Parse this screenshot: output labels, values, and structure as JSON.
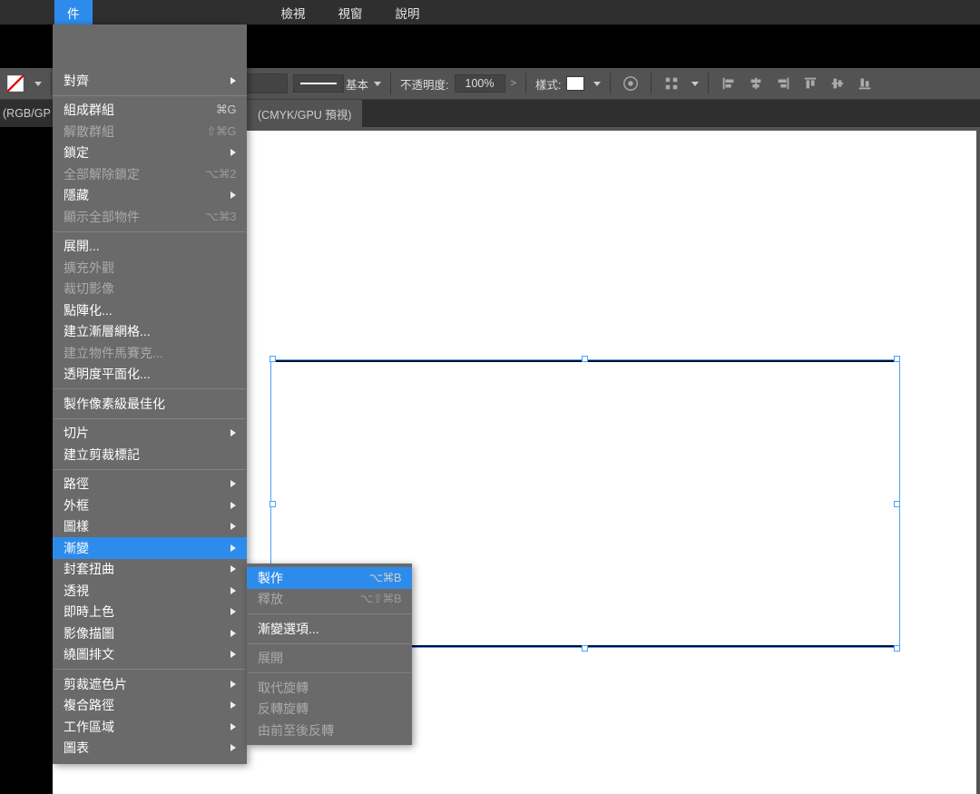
{
  "menubar": {
    "active_label": "件",
    "items": [
      "檢視",
      "視窗",
      "說明"
    ]
  },
  "optionsbar": {
    "stroke_style_label": "基本",
    "opacity_label": "不透明度:",
    "opacity_value": "100%",
    "style_label": "樣式:"
  },
  "doctabs": {
    "tab1": "(RGB/GP",
    "tab2": "(CMYK/GPU 預視)"
  },
  "menu": {
    "items": [
      {
        "label": "對齊",
        "submenu": true
      },
      {
        "sep": true
      },
      {
        "label": "組成群組",
        "shortcut": "⌘G"
      },
      {
        "label": "解散群組",
        "shortcut": "⇧⌘G",
        "disabled": true
      },
      {
        "label": "鎖定",
        "submenu": true
      },
      {
        "label": "全部解除鎖定",
        "shortcut": "⌥⌘2",
        "disabled": true
      },
      {
        "label": "隱藏",
        "submenu": true
      },
      {
        "label": "顯示全部物件",
        "shortcut": "⌥⌘3",
        "disabled": true
      },
      {
        "sep": true
      },
      {
        "label": "展開..."
      },
      {
        "label": "擴充外觀",
        "disabled": true
      },
      {
        "label": "裁切影像",
        "disabled": true
      },
      {
        "label": "點陣化..."
      },
      {
        "label": "建立漸層網格..."
      },
      {
        "label": "建立物件馬賽克...",
        "disabled": true
      },
      {
        "label": "透明度平面化..."
      },
      {
        "sep": true
      },
      {
        "label": "製作像素級最佳化"
      },
      {
        "sep": true
      },
      {
        "label": "切片",
        "submenu": true
      },
      {
        "label": "建立剪裁標記"
      },
      {
        "sep": true
      },
      {
        "label": "路徑",
        "submenu": true
      },
      {
        "label": "外框",
        "submenu": true
      },
      {
        "label": "圖樣",
        "submenu": true
      },
      {
        "label": "漸變",
        "submenu": true,
        "highlighted": true
      },
      {
        "label": "封套扭曲",
        "submenu": true
      },
      {
        "label": "透視",
        "submenu": true
      },
      {
        "label": "即時上色",
        "submenu": true
      },
      {
        "label": "影像描圖",
        "submenu": true
      },
      {
        "label": "繞圖排文",
        "submenu": true
      },
      {
        "sep": true
      },
      {
        "label": "剪裁遮色片",
        "submenu": true
      },
      {
        "label": "複合路徑",
        "submenu": true
      },
      {
        "label": "工作區域",
        "submenu": true
      },
      {
        "label": "圖表",
        "submenu": true
      }
    ]
  },
  "submenu": {
    "items": [
      {
        "label": "製作",
        "shortcut": "⌥⌘B",
        "highlighted": true
      },
      {
        "label": "釋放",
        "shortcut": "⌥⇧⌘B",
        "disabled": true
      },
      {
        "sep": true
      },
      {
        "label": "漸變選項..."
      },
      {
        "sep": true
      },
      {
        "label": "展開",
        "disabled": true
      },
      {
        "sep": true
      },
      {
        "label": "取代旋轉",
        "disabled": true
      },
      {
        "label": "反轉旋轉",
        "disabled": true
      },
      {
        "label": "由前至後反轉",
        "disabled": true
      }
    ]
  }
}
